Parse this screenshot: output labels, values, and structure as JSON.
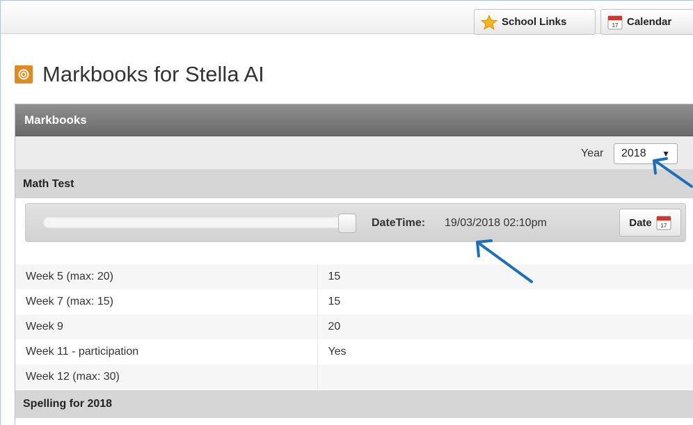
{
  "topbar": {
    "school_links_label": "School Links",
    "calendar_label": "Calendar"
  },
  "page": {
    "title": "Markbooks for Stella AI"
  },
  "panel": {
    "heading": "Markbooks",
    "year_label": "Year",
    "year_value": "2018"
  },
  "sections": [
    {
      "title": "Math Test",
      "datetime_label": "DateTime:",
      "datetime_value": "19/03/2018 02:10pm",
      "date_button_label": "Date",
      "rows": [
        {
          "name": "Week 5 (max: 20)",
          "value": "15"
        },
        {
          "name": "Week 7 (max: 15)",
          "value": "15"
        },
        {
          "name": "Week 9",
          "value": "20"
        },
        {
          "name": "Week 11 - participation",
          "value": "Yes"
        },
        {
          "name": "Week 12 (max: 30)",
          "value": ""
        }
      ]
    },
    {
      "title": "Spelling for 2018"
    }
  ],
  "colors": {
    "accent_orange": "#e18a22",
    "panel_header": "#7a7a7a",
    "annotation_arrow": "#1f6fb8"
  },
  "icons": [
    "star-icon",
    "calendar-icon",
    "markbook-icon",
    "chevron-down-icon"
  ]
}
